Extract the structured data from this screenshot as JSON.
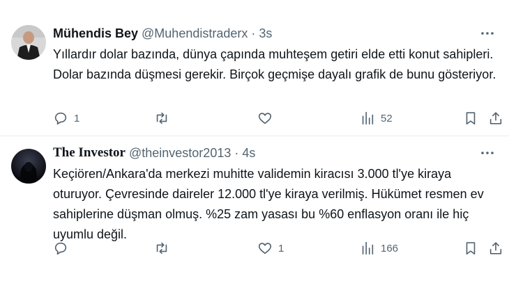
{
  "tweets": [
    {
      "name": "Mühendis Bey",
      "handle": "@Muhendistraderx",
      "separator": "·",
      "time": "3s",
      "text": "Yıllardır dolar bazında, dünya çapında muhteşem getiri elde etti konut sahipleri. Dolar bazında düşmesi gerekir. Birçok geçmişe dayalı grafik de bunu gösteriyor.",
      "reply_count": "1",
      "retweet_count": "",
      "like_count": "",
      "view_count": "52"
    },
    {
      "name": "The Investor",
      "handle": "@theinvestor2013",
      "separator": "·",
      "time": "4s",
      "text": "Keçiören/Ankara'da merkezi muhitte validemin kiracısı 3.000 tl'ye kiraya oturuyor. Çevresinde daireler 12.000 tl'ye kiraya verilmiş. Hükümet resmen ev sahiplerine düşman olmuş. %25 zam yasası bu %60 enflasyon oranı ile hiç uyumlu değil.",
      "reply_count": "",
      "retweet_count": "",
      "like_count": "1",
      "view_count": "166"
    }
  ],
  "colors": {
    "text": "#0f1419",
    "secondary": "#536471",
    "divider": "#e6ecf0"
  },
  "icons": [
    "avatar-photo",
    "more-icon",
    "reply-icon",
    "retweet-icon",
    "like-icon",
    "views-icon",
    "bookmark-icon",
    "share-icon"
  ]
}
